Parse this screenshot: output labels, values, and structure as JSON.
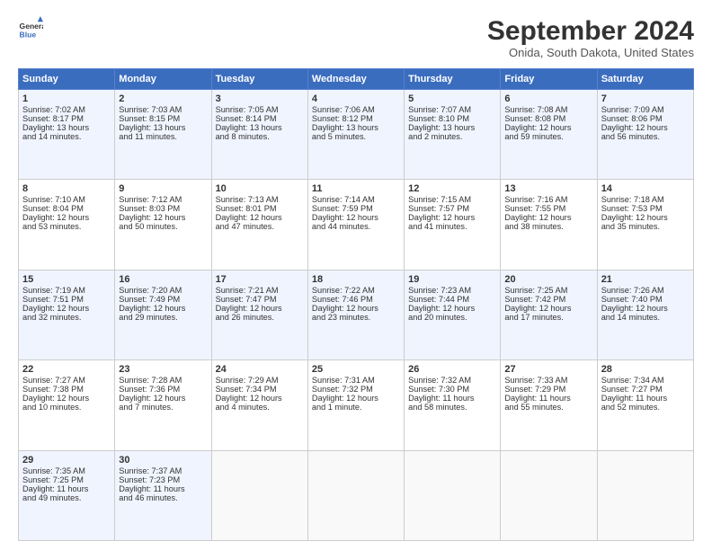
{
  "header": {
    "logo_line1": "General",
    "logo_line2": "Blue",
    "month_title": "September 2024",
    "location": "Onida, South Dakota, United States"
  },
  "days_of_week": [
    "Sunday",
    "Monday",
    "Tuesday",
    "Wednesday",
    "Thursday",
    "Friday",
    "Saturday"
  ],
  "weeks": [
    [
      {
        "day": 1,
        "lines": [
          "Sunrise: 7:02 AM",
          "Sunset: 8:17 PM",
          "Daylight: 13 hours",
          "and 14 minutes."
        ]
      },
      {
        "day": 2,
        "lines": [
          "Sunrise: 7:03 AM",
          "Sunset: 8:15 PM",
          "Daylight: 13 hours",
          "and 11 minutes."
        ]
      },
      {
        "day": 3,
        "lines": [
          "Sunrise: 7:05 AM",
          "Sunset: 8:14 PM",
          "Daylight: 13 hours",
          "and 8 minutes."
        ]
      },
      {
        "day": 4,
        "lines": [
          "Sunrise: 7:06 AM",
          "Sunset: 8:12 PM",
          "Daylight: 13 hours",
          "and 5 minutes."
        ]
      },
      {
        "day": 5,
        "lines": [
          "Sunrise: 7:07 AM",
          "Sunset: 8:10 PM",
          "Daylight: 13 hours",
          "and 2 minutes."
        ]
      },
      {
        "day": 6,
        "lines": [
          "Sunrise: 7:08 AM",
          "Sunset: 8:08 PM",
          "Daylight: 12 hours",
          "and 59 minutes."
        ]
      },
      {
        "day": 7,
        "lines": [
          "Sunrise: 7:09 AM",
          "Sunset: 8:06 PM",
          "Daylight: 12 hours",
          "and 56 minutes."
        ]
      }
    ],
    [
      {
        "day": 8,
        "lines": [
          "Sunrise: 7:10 AM",
          "Sunset: 8:04 PM",
          "Daylight: 12 hours",
          "and 53 minutes."
        ]
      },
      {
        "day": 9,
        "lines": [
          "Sunrise: 7:12 AM",
          "Sunset: 8:03 PM",
          "Daylight: 12 hours",
          "and 50 minutes."
        ]
      },
      {
        "day": 10,
        "lines": [
          "Sunrise: 7:13 AM",
          "Sunset: 8:01 PM",
          "Daylight: 12 hours",
          "and 47 minutes."
        ]
      },
      {
        "day": 11,
        "lines": [
          "Sunrise: 7:14 AM",
          "Sunset: 7:59 PM",
          "Daylight: 12 hours",
          "and 44 minutes."
        ]
      },
      {
        "day": 12,
        "lines": [
          "Sunrise: 7:15 AM",
          "Sunset: 7:57 PM",
          "Daylight: 12 hours",
          "and 41 minutes."
        ]
      },
      {
        "day": 13,
        "lines": [
          "Sunrise: 7:16 AM",
          "Sunset: 7:55 PM",
          "Daylight: 12 hours",
          "and 38 minutes."
        ]
      },
      {
        "day": 14,
        "lines": [
          "Sunrise: 7:18 AM",
          "Sunset: 7:53 PM",
          "Daylight: 12 hours",
          "and 35 minutes."
        ]
      }
    ],
    [
      {
        "day": 15,
        "lines": [
          "Sunrise: 7:19 AM",
          "Sunset: 7:51 PM",
          "Daylight: 12 hours",
          "and 32 minutes."
        ]
      },
      {
        "day": 16,
        "lines": [
          "Sunrise: 7:20 AM",
          "Sunset: 7:49 PM",
          "Daylight: 12 hours",
          "and 29 minutes."
        ]
      },
      {
        "day": 17,
        "lines": [
          "Sunrise: 7:21 AM",
          "Sunset: 7:47 PM",
          "Daylight: 12 hours",
          "and 26 minutes."
        ]
      },
      {
        "day": 18,
        "lines": [
          "Sunrise: 7:22 AM",
          "Sunset: 7:46 PM",
          "Daylight: 12 hours",
          "and 23 minutes."
        ]
      },
      {
        "day": 19,
        "lines": [
          "Sunrise: 7:23 AM",
          "Sunset: 7:44 PM",
          "Daylight: 12 hours",
          "and 20 minutes."
        ]
      },
      {
        "day": 20,
        "lines": [
          "Sunrise: 7:25 AM",
          "Sunset: 7:42 PM",
          "Daylight: 12 hours",
          "and 17 minutes."
        ]
      },
      {
        "day": 21,
        "lines": [
          "Sunrise: 7:26 AM",
          "Sunset: 7:40 PM",
          "Daylight: 12 hours",
          "and 14 minutes."
        ]
      }
    ],
    [
      {
        "day": 22,
        "lines": [
          "Sunrise: 7:27 AM",
          "Sunset: 7:38 PM",
          "Daylight: 12 hours",
          "and 10 minutes."
        ]
      },
      {
        "day": 23,
        "lines": [
          "Sunrise: 7:28 AM",
          "Sunset: 7:36 PM",
          "Daylight: 12 hours",
          "and 7 minutes."
        ]
      },
      {
        "day": 24,
        "lines": [
          "Sunrise: 7:29 AM",
          "Sunset: 7:34 PM",
          "Daylight: 12 hours",
          "and 4 minutes."
        ]
      },
      {
        "day": 25,
        "lines": [
          "Sunrise: 7:31 AM",
          "Sunset: 7:32 PM",
          "Daylight: 12 hours",
          "and 1 minute."
        ]
      },
      {
        "day": 26,
        "lines": [
          "Sunrise: 7:32 AM",
          "Sunset: 7:30 PM",
          "Daylight: 11 hours",
          "and 58 minutes."
        ]
      },
      {
        "day": 27,
        "lines": [
          "Sunrise: 7:33 AM",
          "Sunset: 7:29 PM",
          "Daylight: 11 hours",
          "and 55 minutes."
        ]
      },
      {
        "day": 28,
        "lines": [
          "Sunrise: 7:34 AM",
          "Sunset: 7:27 PM",
          "Daylight: 11 hours",
          "and 52 minutes."
        ]
      }
    ],
    [
      {
        "day": 29,
        "lines": [
          "Sunrise: 7:35 AM",
          "Sunset: 7:25 PM",
          "Daylight: 11 hours",
          "and 49 minutes."
        ]
      },
      {
        "day": 30,
        "lines": [
          "Sunrise: 7:37 AM",
          "Sunset: 7:23 PM",
          "Daylight: 11 hours",
          "and 46 minutes."
        ]
      },
      {
        "day": null,
        "lines": []
      },
      {
        "day": null,
        "lines": []
      },
      {
        "day": null,
        "lines": []
      },
      {
        "day": null,
        "lines": []
      },
      {
        "day": null,
        "lines": []
      }
    ]
  ]
}
